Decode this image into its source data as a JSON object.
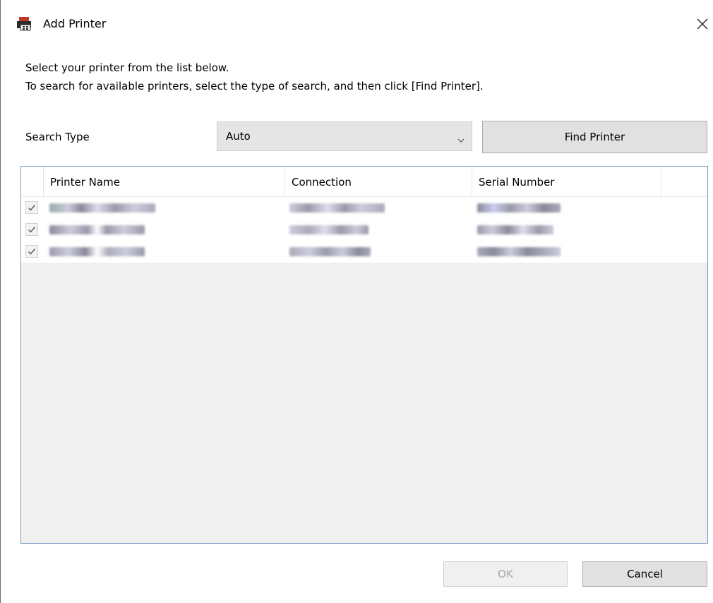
{
  "window": {
    "title": "Add Printer"
  },
  "instructions": {
    "line1": "Select your printer from the list below.",
    "line2": "To search for available printers, select the type of search, and then click [Find Printer]."
  },
  "search": {
    "label": "Search Type",
    "selected": "Auto",
    "find_button": "Find Printer"
  },
  "table": {
    "columns": [
      "Printer Name",
      "Connection",
      "Serial Number"
    ],
    "rows": [
      {
        "checked": true
      },
      {
        "checked": true
      },
      {
        "checked": true
      }
    ]
  },
  "footer": {
    "ok_label": "OK",
    "cancel_label": "Cancel"
  },
  "colors": {
    "list_border": "#7a9cc6",
    "button_face": "#e1e1e1",
    "disabled_text": "#a8a8a8"
  },
  "icons": {
    "app": "printer-icon",
    "close": "close-icon",
    "dropdown": "chevron-down-icon",
    "row_check": "checkmark-icon"
  }
}
